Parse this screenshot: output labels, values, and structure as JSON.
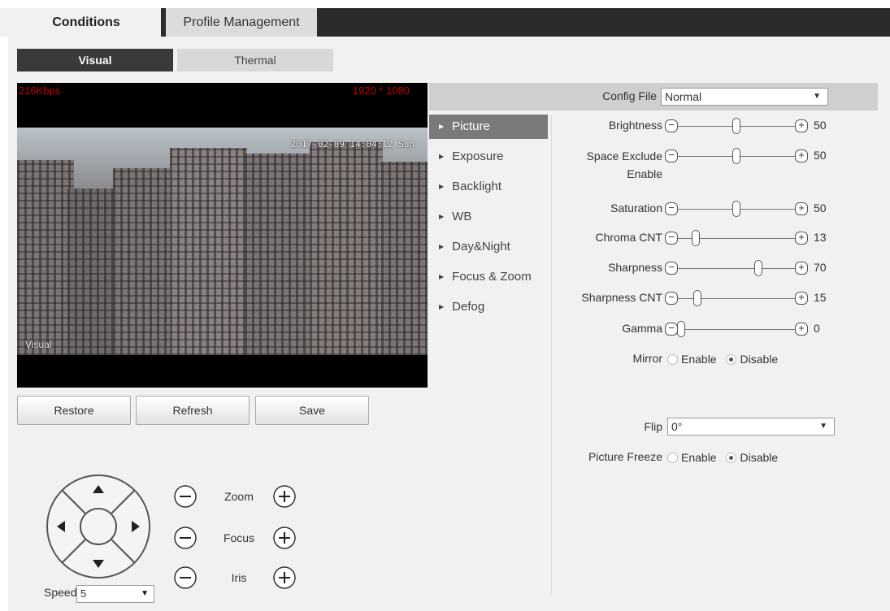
{
  "top_tabs": {
    "conditions": "Conditions",
    "profile": "Profile Management"
  },
  "sub_tabs": {
    "visual": "Visual",
    "thermal": "Thermal"
  },
  "video": {
    "bitrate": "216Kbps",
    "resolution": "1920 * 1080",
    "timestamp": "2017-02-09 14:04:12 Sun",
    "channel_name": "Visual"
  },
  "buttons": {
    "restore": "Restore",
    "refresh": "Refresh",
    "save": "Save"
  },
  "ptz": {
    "speed_label": "Speed",
    "speed_value": "5"
  },
  "lens": {
    "zoom": "Zoom",
    "focus": "Focus",
    "iris": "Iris"
  },
  "config": {
    "file_label": "Config File",
    "file_value": "Normal"
  },
  "menu": [
    "Picture",
    "Exposure",
    "Backlight",
    "WB",
    "Day&Night",
    "Focus & Zoom",
    "Defog"
  ],
  "settings": {
    "brightness": {
      "label": "Brightness",
      "value": 50
    },
    "space_exclude": {
      "label_line1": "Space Exclude",
      "label_line2": "Enable",
      "value": 50
    },
    "saturation": {
      "label": "Saturation",
      "value": 50
    },
    "chroma_cnt": {
      "label": "Chroma CNT",
      "value": 13
    },
    "sharpness": {
      "label": "Sharpness",
      "value": 70
    },
    "sharpness_cnt": {
      "label": "Sharpness CNT",
      "value": 15
    },
    "gamma": {
      "label": "Gamma",
      "value": 0
    },
    "mirror": {
      "label": "Mirror",
      "enable": "Enable",
      "disable": "Disable",
      "selected": "Disable"
    },
    "flip": {
      "label": "Flip",
      "value": "0°"
    },
    "picture_freeze": {
      "label": "Picture Freeze",
      "enable": "Enable",
      "disable": "Disable",
      "selected": "Disable"
    }
  },
  "colors": {
    "active_tab": "#3a3a3a",
    "osd_text": "#c00000",
    "menu_active": "#7a7a7a"
  }
}
